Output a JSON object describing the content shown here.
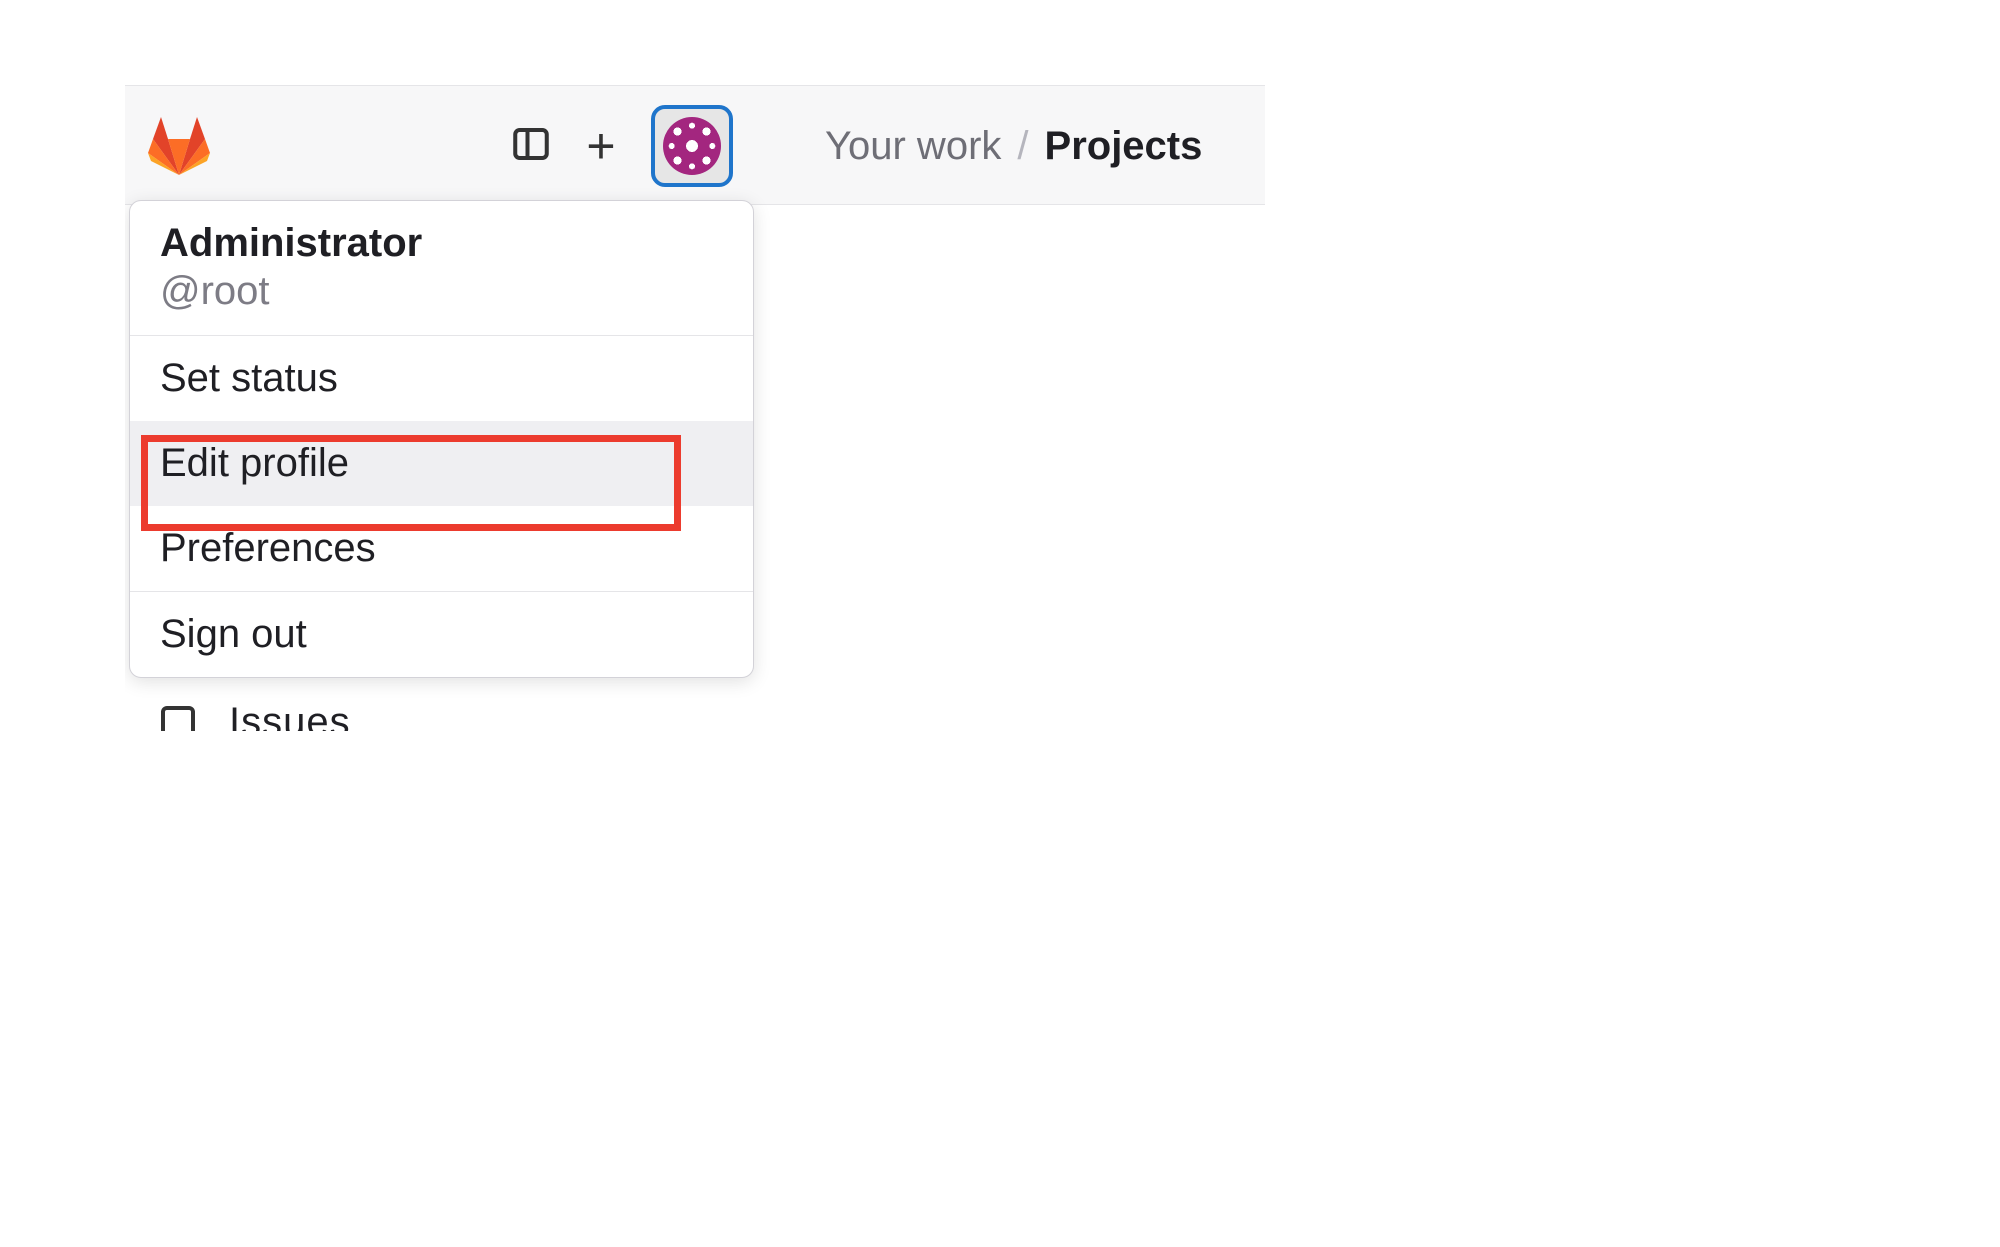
{
  "breadcrumb": {
    "root": "Your work",
    "separator": "/",
    "current": "Projects"
  },
  "user": {
    "display_name": "Administrator",
    "handle": "@root"
  },
  "dropdown": {
    "items": [
      {
        "label": "Set status"
      },
      {
        "label": "Edit profile"
      },
      {
        "label": "Preferences"
      }
    ],
    "signout": "Sign out",
    "highlighted_index": 1
  },
  "peek": {
    "label": "Issues"
  },
  "icons": {
    "logo": "gitlab-logo-icon",
    "sidebar_toggle": "sidebar-toggle-icon",
    "create": "plus-icon",
    "avatar": "user-avatar-icon"
  }
}
